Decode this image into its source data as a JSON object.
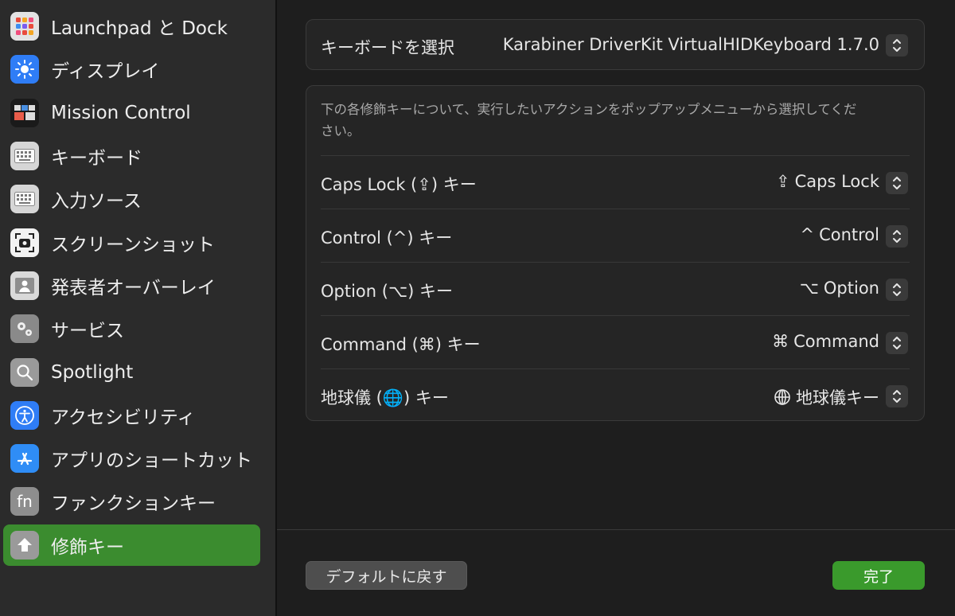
{
  "sidebar": {
    "items": [
      {
        "label": "Launchpad と Dock",
        "icon": "launchpad-icon",
        "active": false
      },
      {
        "label": "ディスプレイ",
        "icon": "display-sun-icon",
        "active": false
      },
      {
        "label": "Mission Control",
        "icon": "mission-control-icon",
        "active": false
      },
      {
        "label": "キーボード",
        "icon": "keyboard-icon",
        "active": false
      },
      {
        "label": "入力ソース",
        "icon": "input-source-keyboard-icon",
        "active": false
      },
      {
        "label": "スクリーンショット",
        "icon": "screenshot-icon",
        "active": false
      },
      {
        "label": "発表者オーバーレイ",
        "icon": "presenter-overlay-icon",
        "active": false
      },
      {
        "label": "サービス",
        "icon": "services-gears-icon",
        "active": false
      },
      {
        "label": "Spotlight",
        "icon": "spotlight-search-icon",
        "active": false
      },
      {
        "label": "アクセシビリティ",
        "icon": "accessibility-icon",
        "active": false
      },
      {
        "label": "アプリのショートカット",
        "icon": "app-store-icon",
        "active": false
      },
      {
        "label": "ファンクションキー",
        "icon": "fn-key-icon",
        "active": false
      },
      {
        "label": "修飾キー",
        "icon": "modifier-key-icon",
        "active": true
      }
    ]
  },
  "keyboard_select": {
    "label": "キーボードを選択",
    "value": "Karabiner DriverKit VirtualHIDKeyboard 1.7.0"
  },
  "modifiers": {
    "hint": "下の各修飾キーについて、実行したいアクションをポップアップメニューから選択してください。",
    "rows": [
      {
        "label": "Caps Lock (⇪) キー",
        "value_symbol": "⇪",
        "value": "Caps Lock"
      },
      {
        "label": "Control (^) キー",
        "value_symbol": "^",
        "value": "Control"
      },
      {
        "label": "Option (⌥) キー",
        "value_symbol": "⌥",
        "value": "Option"
      },
      {
        "label": "Command (⌘) キー",
        "value_symbol": "⌘",
        "value": "Command"
      },
      {
        "label": "地球儀 (🌐) キー",
        "value_symbol": "globe",
        "value": "地球儀キー"
      }
    ]
  },
  "footer": {
    "restore_label": "デフォルトに戻す",
    "done_label": "完了"
  },
  "colors": {
    "accent_green": "#3b8c2f",
    "done_green": "#3a9a2c"
  }
}
